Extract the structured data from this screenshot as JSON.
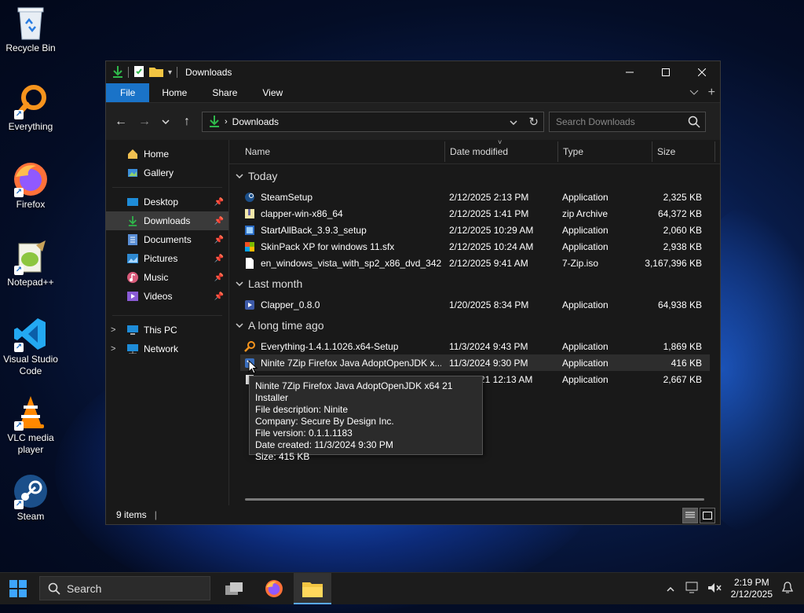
{
  "desktop": {
    "icons": [
      {
        "label": "Recycle Bin",
        "icon": "recycle-bin-icon"
      },
      {
        "label": "Everything",
        "icon": "everything-icon"
      },
      {
        "label": "Firefox",
        "icon": "firefox-icon"
      },
      {
        "label": "Notepad++",
        "icon": "notepad-plus-plus-icon"
      },
      {
        "label": "Visual Studio Code",
        "icon": "vscode-icon"
      },
      {
        "label": "VLC media player",
        "icon": "vlc-icon"
      },
      {
        "label": "Steam",
        "icon": "steam-icon"
      }
    ]
  },
  "window": {
    "title": "Downloads",
    "ribbon_tabs": [
      "File",
      "Home",
      "Share",
      "View"
    ],
    "address": {
      "crumb": "Downloads"
    },
    "search": {
      "placeholder": "Search Downloads"
    },
    "nav": {
      "items": [
        {
          "label": "Home"
        },
        {
          "label": "Gallery"
        },
        {
          "label": "Desktop"
        },
        {
          "label": "Downloads"
        },
        {
          "label": "Documents"
        },
        {
          "label": "Pictures"
        },
        {
          "label": "Music"
        },
        {
          "label": "Videos"
        },
        {
          "label": "This PC"
        },
        {
          "label": "Network"
        }
      ]
    },
    "columns": {
      "name": "Name",
      "date": "Date modified",
      "type": "Type",
      "size": "Size"
    },
    "groups": {
      "today": "Today",
      "last_month": "Last month",
      "long_ago": "A long time ago"
    },
    "files": [
      {
        "name": "SteamSetup",
        "date": "2/12/2025 2:13 PM",
        "type": "Application",
        "size": "2,325 KB"
      },
      {
        "name": "clapper-win-x86_64",
        "date": "2/12/2025 1:41 PM",
        "type": "zip Archive",
        "size": "64,372 KB"
      },
      {
        "name": "StartAllBack_3.9.3_setup",
        "date": "2/12/2025 10:29 AM",
        "type": "Application",
        "size": "2,060 KB"
      },
      {
        "name": "SkinPack XP for windows 11.sfx",
        "date": "2/12/2025 10:24 AM",
        "type": "Application",
        "size": "2,938 KB"
      },
      {
        "name": "en_windows_vista_with_sp2_x86_dvd_342...",
        "date": "2/12/2025 9:41 AM",
        "type": "7-Zip.iso",
        "size": "3,167,396 KB"
      },
      {
        "name": "Clapper_0.8.0",
        "date": "1/20/2025 8:34 PM",
        "type": "Application",
        "size": "64,938 KB"
      },
      {
        "name": "Everything-1.4.1.1026.x64-Setup",
        "date": "11/3/2024 9:43 PM",
        "type": "Application",
        "size": "1,869 KB"
      },
      {
        "name": "Ninite 7Zip Firefox Java AdoptOpenJDK x...",
        "date": "11/3/2024 9:30 PM",
        "type": "Application",
        "size": "416 KB"
      },
      {
        "name": "",
        "date": "21 12:13 AM",
        "type": "Application",
        "size": "2,667 KB"
      }
    ],
    "tooltip": {
      "line1": "Ninite 7Zip Firefox Java AdoptOpenJDK x64 21 Installer",
      "line2": "File description: Ninite",
      "line3": "Company: Secure By Design Inc.",
      "line4": "File version: 0.1.1.1183",
      "line5": "Date created: 11/3/2024 9:30 PM",
      "line6": "Size: 415 KB"
    },
    "status": "9 items"
  },
  "taskbar": {
    "search_label": "Search",
    "time": "2:19 PM",
    "date": "2/12/2025"
  },
  "colors": {
    "accent": "#1a73c8",
    "window_bg": "#191919",
    "taskbar_bg": "#1c1c1c"
  }
}
